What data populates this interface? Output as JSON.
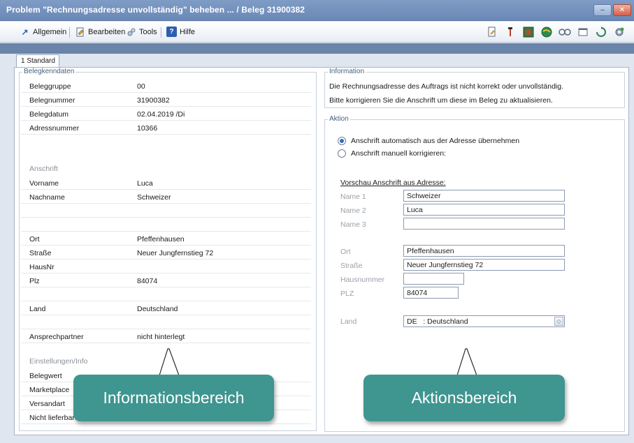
{
  "window": {
    "title": "Problem \"Rechnungsadresse unvollständig\" beheben ... / Beleg 31900382",
    "minimize_label": "–",
    "close_label": "✕"
  },
  "toolbar": {
    "allgemein": "Allgemein",
    "bearbeiten": "Bearbeiten",
    "tools": "Tools",
    "hilfe": "Hilfe"
  },
  "tabs": {
    "standard": "1 Standard"
  },
  "belegkenndaten": {
    "legend": "Belegkenndaten",
    "rows": [
      {
        "label": "Beleggruppe",
        "value": "00"
      },
      {
        "label": "Belegnummer",
        "value": "31900382"
      },
      {
        "label": "Belegdatum",
        "value": "02.04.2019 /Di"
      },
      {
        "label": "Adressnummer",
        "value": "10366"
      }
    ],
    "anschrift_heading": "Anschrift",
    "name_rows": [
      {
        "label": "Vorname",
        "value": "Luca"
      },
      {
        "label": "Nachname",
        "value": "Schweizer"
      }
    ],
    "ort_rows": [
      {
        "label": "Ort",
        "value": "Pfeffenhausen"
      },
      {
        "label": "Straße",
        "value": "Neuer Jungfernstieg 72"
      },
      {
        "label": "HausNr",
        "value": ""
      },
      {
        "label": "Plz",
        "value": "84074"
      }
    ],
    "land": {
      "label": "Land",
      "value": "Deutschland"
    },
    "ansprechpartner": {
      "label": "Ansprechpartner",
      "value": "nicht hinterlegt"
    },
    "einstellungen_heading": "Einstellungen/Info",
    "info_rows": [
      {
        "label": "Belegwert",
        "value": ""
      },
      {
        "label": "Marketplace",
        "value": ""
      },
      {
        "label": "Versandart",
        "value": ""
      },
      {
        "label": "Nicht lieferbare Positionen",
        "value": ""
      }
    ]
  },
  "information": {
    "legend": "Information",
    "line1": "Die Rechnungsadresse des Auftrags ist nicht korrekt oder unvollständig.",
    "line2": "Bitte korrigieren Sie die Anschrift um diese im Beleg zu aktualisieren."
  },
  "aktion": {
    "legend": "Aktion",
    "option_auto": "Anschrift automatisch aus der Adresse übernehmen",
    "option_manual": "Anschrift manuell korrigieren:",
    "preview_title": "Vorschau Anschrift aus Adresse:",
    "name1_label": "Name 1",
    "name1_value": "Schweizer",
    "name2_label": "Name 2",
    "name2_value": "Luca",
    "name3_label": "Name 3",
    "name3_value": "",
    "ort_label": "Ort",
    "ort_value": "Pfeffenhausen",
    "strasse_label": "Straße",
    "strasse_value": "Neuer Jungfernstieg 72",
    "hausnummer_label": "Hausnummer",
    "hausnummer_value": "",
    "plz_label": "PLZ",
    "plz_value": "84074",
    "land_label": "Land",
    "land_value": "DE   : Deutschland"
  },
  "callouts": {
    "info": "Informationsbereich",
    "aktion": "Aktionsbereich"
  },
  "colors": {
    "titlebar": "#6a88b6",
    "callout": "#3f9590",
    "radio_selected": "#2f6bc4"
  }
}
